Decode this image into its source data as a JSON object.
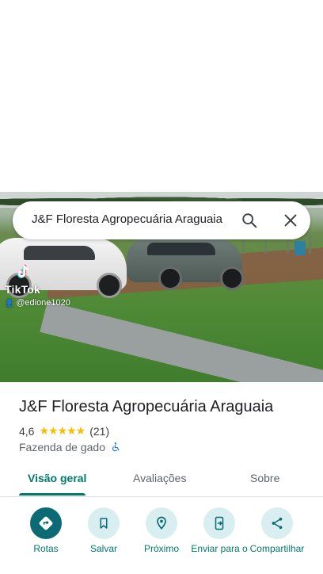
{
  "search": {
    "query": "J&F Floresta Agropecuária Araguaia"
  },
  "photo": {
    "watermark_brand": "TikTok",
    "watermark_user": "@edione1020"
  },
  "place": {
    "name": "J&F Floresta Agropecuária Araguaia",
    "rating": "4,6",
    "stars": "★★★★★",
    "reviews_count": "(21)",
    "category": "Fazenda de gado"
  },
  "tabs": [
    {
      "label": "Visão geral"
    },
    {
      "label": "Avaliações"
    },
    {
      "label": "Sobre"
    }
  ],
  "actions": [
    {
      "label": "Rotas",
      "icon": "directions-icon"
    },
    {
      "label": "Salvar",
      "icon": "bookmark-icon"
    },
    {
      "label": "Próximo",
      "icon": "nearby-icon"
    },
    {
      "label": "Enviar para o",
      "icon": "send-to-phone-icon"
    },
    {
      "label": "Compartilhar",
      "icon": "share-icon"
    }
  ],
  "colors": {
    "accent": "#00796b",
    "primary_button": "#0b6a74",
    "button_bg": "#d8eef0",
    "star": "#fbbc04"
  }
}
